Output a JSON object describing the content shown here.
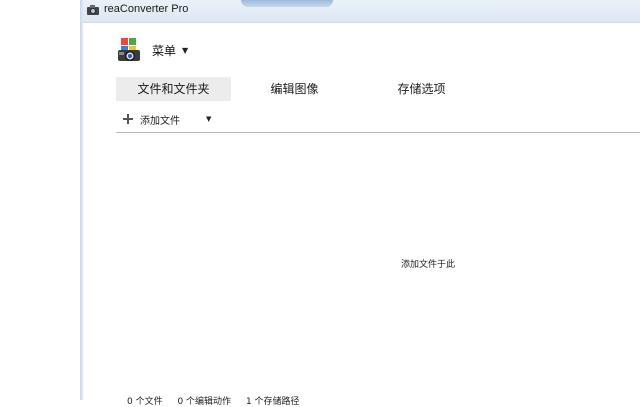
{
  "window": {
    "title": "reaConverter Pro"
  },
  "menu": {
    "label": "菜单"
  },
  "tabs": [
    {
      "label": "文件和文件夹",
      "active": true
    },
    {
      "label": "编辑图像",
      "active": false
    },
    {
      "label": "存储选项",
      "active": false
    }
  ],
  "toolbar": {
    "add_files_label": "添加文件"
  },
  "drop_area": {
    "hint": "添加文件于此"
  },
  "status": {
    "files": "0 个文件",
    "actions": "0 个编辑动作",
    "paths": "1 个存储路径"
  },
  "colors": {
    "active_tab_bg": "#ececec",
    "divider": "#b9b9b9",
    "titlebar": "#dde8f3"
  }
}
